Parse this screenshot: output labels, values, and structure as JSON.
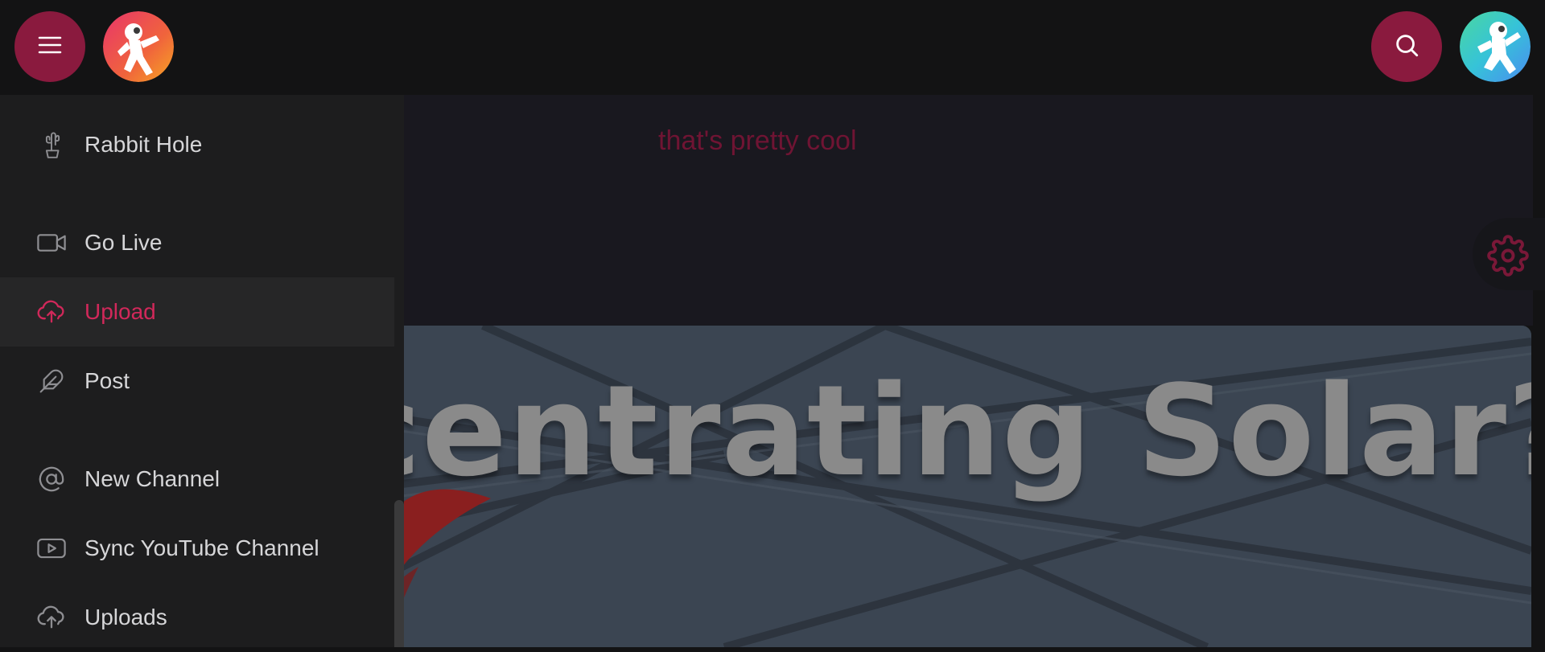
{
  "colors": {
    "accent": "#8a1a3e",
    "active_text": "#d1285a",
    "menu_bg": "#1d1d1e",
    "page_bg": "#131314"
  },
  "header": {
    "menu_button_icon": "hamburger-icon",
    "logo_icon": "astronaut-logo",
    "search_button_icon": "search-icon",
    "user_avatar_icon": "astronaut-avatar"
  },
  "content": {
    "comment_text": "that's pretty cool",
    "settings_icon": "gear-icon",
    "thumbnail_title": "Concentrating Solar?"
  },
  "sidemenu": {
    "items": [
      {
        "label": "Rabbit Hole",
        "icon": "cactus-icon",
        "active": false
      },
      {
        "label": "Go Live",
        "icon": "video-camera-icon",
        "active": false
      },
      {
        "label": "Upload",
        "icon": "cloud-upload-icon",
        "active": true
      },
      {
        "label": "Post",
        "icon": "feather-icon",
        "active": false
      },
      {
        "label": "New Channel",
        "icon": "at-sign-icon",
        "active": false
      },
      {
        "label": "Sync YouTube Channel",
        "icon": "youtube-icon",
        "active": false
      },
      {
        "label": "Uploads",
        "icon": "cloud-upload-icon",
        "active": false
      }
    ]
  }
}
